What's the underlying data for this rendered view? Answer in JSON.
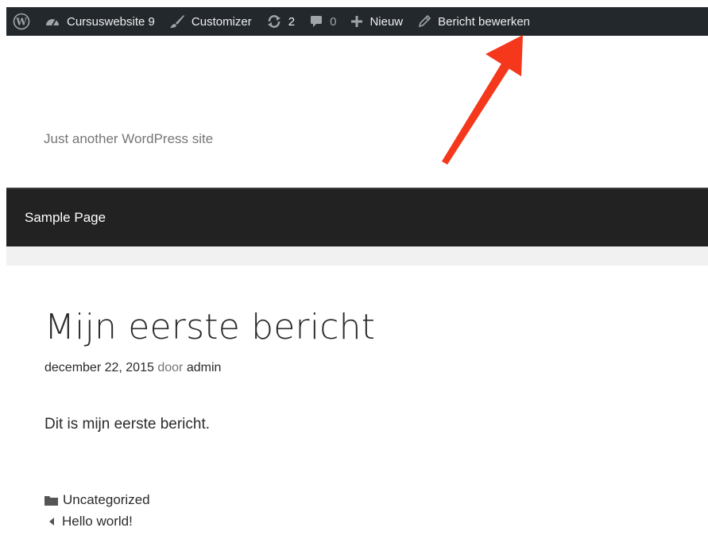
{
  "admin_bar": {
    "site_name": "Cursuswebsite 9",
    "customizer_label": "Customizer",
    "updates_count": "2",
    "comments_count": "0",
    "new_label": "Nieuw",
    "edit_post_label": "Bericht bewerken",
    "icons": {
      "logo": "wordpress-logo-icon",
      "site": "dashboard-gauge-icon",
      "customizer": "paintbrush-icon",
      "updates": "refresh-icon",
      "comments": "speech-bubble-icon",
      "new": "plus-icon",
      "edit": "pencil-icon"
    }
  },
  "header": {
    "tagline": "Just another WordPress site"
  },
  "nav": {
    "items": [
      {
        "label": "Sample Page"
      }
    ]
  },
  "post": {
    "title": "Mijn eerste bericht",
    "date": "december 22, 2015",
    "by_label": "door",
    "author": "admin",
    "content": "Dit is mijn eerste bericht.",
    "category": "Uncategorized",
    "previous_post": "Hello world!"
  },
  "colors": {
    "admin_bar_bg": "#23282d",
    "nav_bg": "#222222",
    "arrow": "#f5371c",
    "page_bg": "#f1f1f1"
  }
}
